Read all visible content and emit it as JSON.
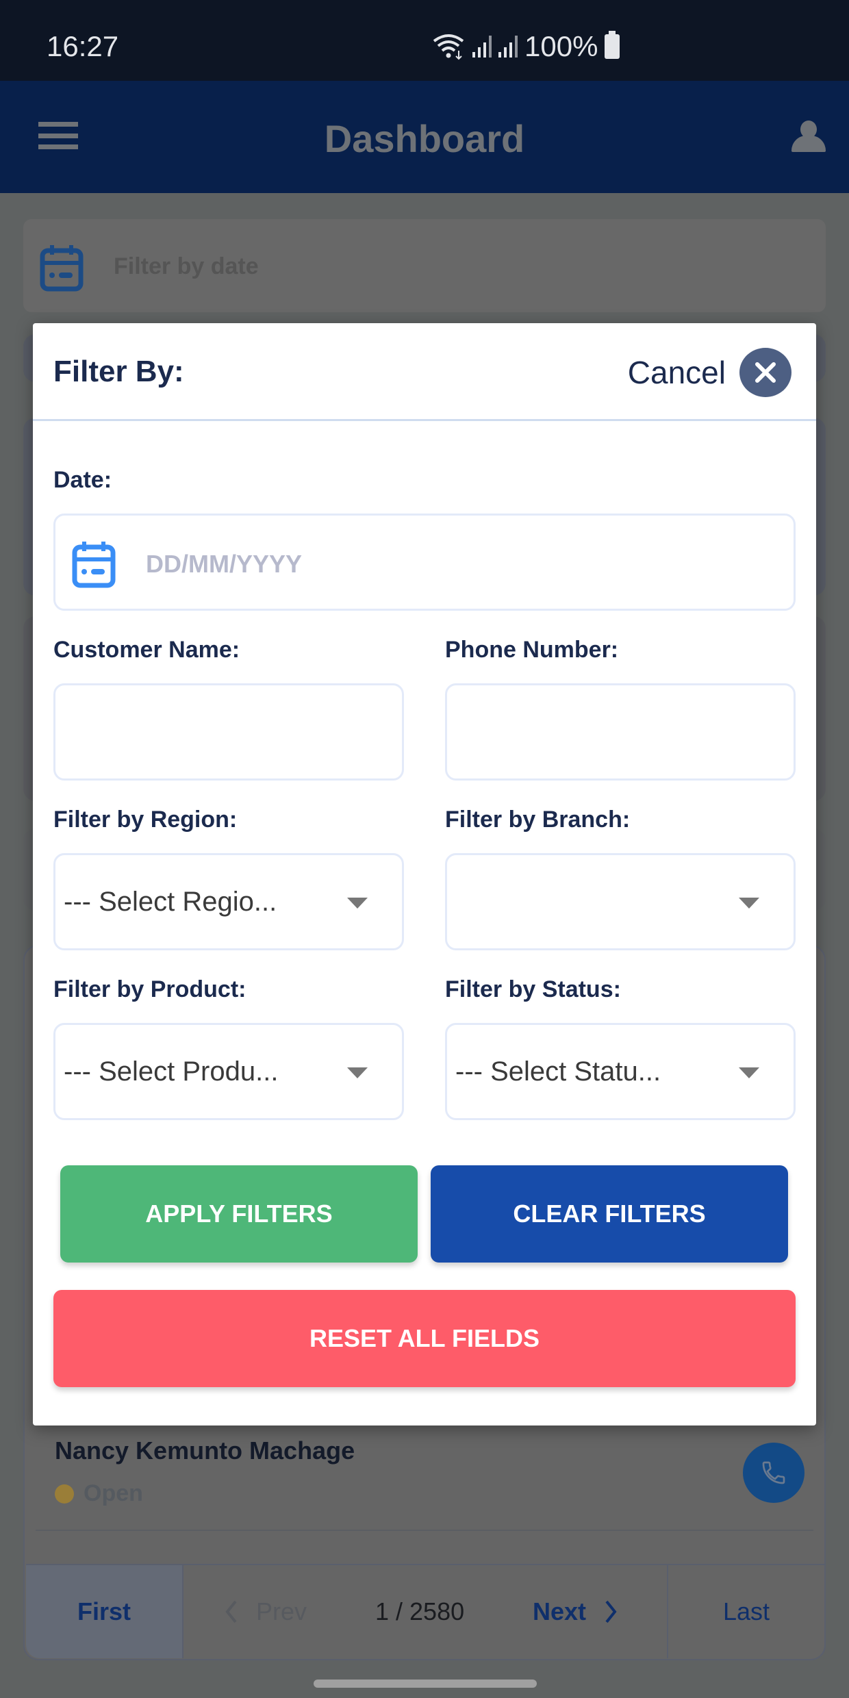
{
  "status_bar": {
    "time": "16:27",
    "battery": "100%"
  },
  "app_bar": {
    "title": "Dashboard",
    "menu_icon": "hamburger-menu-icon",
    "profile_icon": "user-profile-icon"
  },
  "background": {
    "date_filter_label": "Filter by date",
    "list_item": {
      "name": "Nancy Kemunto Machage",
      "status": "Open",
      "status_color": "#9a7e38"
    },
    "pagination": {
      "first": "First",
      "prev": "Prev",
      "page_indicator": "1 / 2580",
      "next": "Next",
      "last": "Last"
    }
  },
  "modal": {
    "title": "Filter By:",
    "cancel_label": "Cancel",
    "fields": {
      "date": {
        "label": "Date:",
        "placeholder": "DD/MM/YYYY",
        "value": ""
      },
      "customer_name": {
        "label": "Customer Name:",
        "value": ""
      },
      "phone_number": {
        "label": "Phone Number:",
        "value": ""
      },
      "region": {
        "label": "Filter by Region:",
        "selected": "--- Select Regio..."
      },
      "branch": {
        "label": "Filter by Branch:",
        "selected": ""
      },
      "product": {
        "label": "Filter by Product:",
        "selected": "--- Select Produ..."
      },
      "status": {
        "label": "Filter by Status:",
        "selected": "--- Select Statu..."
      }
    },
    "buttons": {
      "apply": "APPLY FILTERS",
      "clear": "CLEAR FILTERS",
      "reset": "RESET ALL FIELDS"
    }
  },
  "colors": {
    "primary_dark": "#1b2a4e",
    "apply": "#4eb778",
    "clear": "#174caa",
    "reset": "#fe5c69",
    "calendar_icon": "#3a8ef6"
  }
}
